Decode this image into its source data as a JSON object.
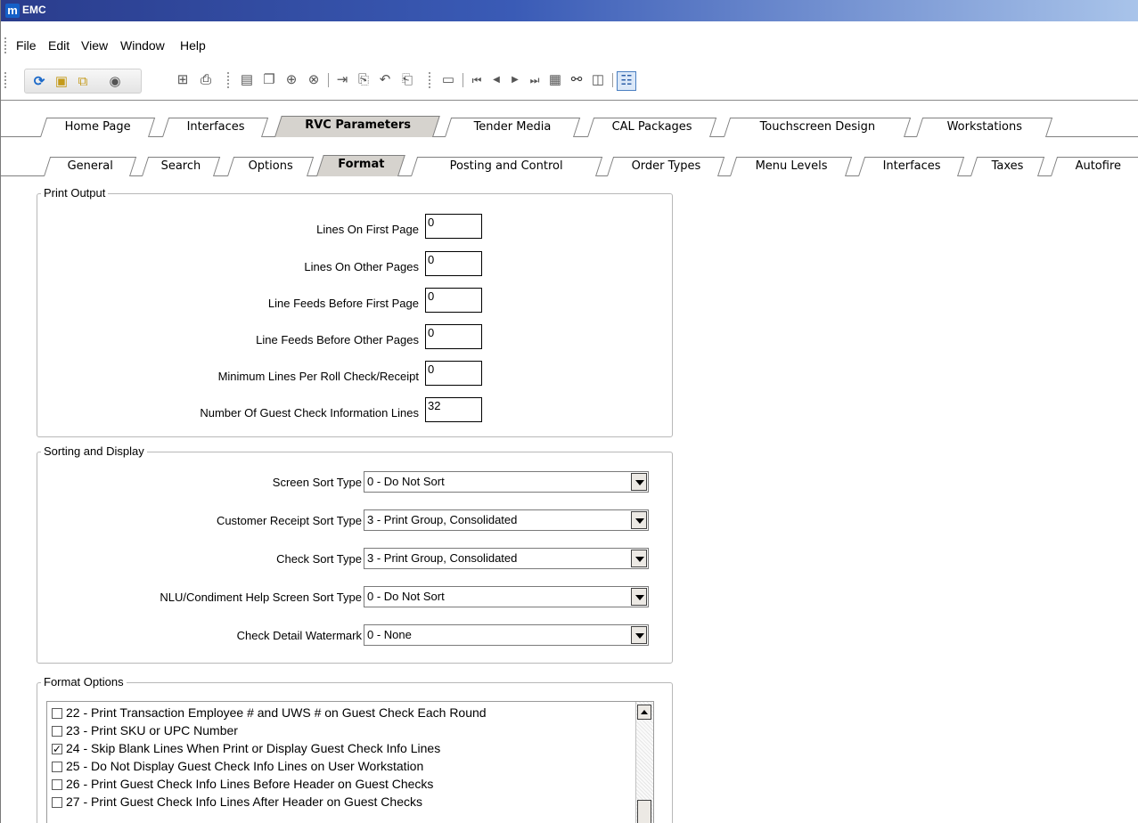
{
  "window": {
    "logo": "m",
    "title": "EMC"
  },
  "menu": [
    "File",
    "Edit",
    "View",
    "Window",
    "Help"
  ],
  "toolbar_icons": [
    "refresh-icon",
    "new-icon",
    "new-multiple-icon",
    "circle-icon",
    "calculator-icon",
    "print-icon",
    "save-icon",
    "save-all-icon",
    "add-icon",
    "delete-icon",
    "insert-record-icon",
    "copy-icon",
    "undo-icon",
    "paste-icon",
    "page-icon",
    "first-record-icon",
    "previous-record-icon",
    "next-record-icon",
    "last-record-icon",
    "goto-record-icon",
    "find-icon",
    "form-view-icon",
    "table-view-icon"
  ],
  "main_tabs": [
    "Home Page",
    "Interfaces",
    "RVC Parameters",
    "Tender Media",
    "CAL Packages",
    "Touchscreen Design",
    "Workstations"
  ],
  "main_tab_active": "RVC Parameters",
  "sub_tabs": [
    "General",
    "Search",
    "Options",
    "Format",
    "Posting and Control",
    "Order Types",
    "Menu Levels",
    "Interfaces",
    "Taxes",
    "Autofire"
  ],
  "sub_tab_active": "Format",
  "print_output": {
    "legend": "Print Output",
    "fields": [
      {
        "label": "Lines On First Page",
        "value": "0"
      },
      {
        "label": "Lines On Other Pages",
        "value": "0"
      },
      {
        "label": "Line Feeds Before First Page",
        "value": "0"
      },
      {
        "label": "Line Feeds Before Other Pages",
        "value": "0"
      },
      {
        "label": "Minimum Lines Per Roll Check/Receipt",
        "value": "0"
      },
      {
        "label": "Number Of Guest Check Information Lines",
        "value": "32"
      }
    ]
  },
  "sorting_display": {
    "legend": "Sorting and Display",
    "fields": [
      {
        "label": "Screen Sort Type",
        "value": "0 - Do Not Sort"
      },
      {
        "label": "Customer Receipt Sort Type",
        "value": "3 - Print Group, Consolidated"
      },
      {
        "label": "Check Sort Type",
        "value": "3 - Print Group, Consolidated"
      },
      {
        "label": "NLU/Condiment Help Screen Sort Type",
        "value": "0 - Do Not Sort"
      },
      {
        "label": "Check Detail Watermark",
        "value": "0 - None"
      }
    ]
  },
  "format_options": {
    "legend": "Format Options",
    "items": [
      {
        "label": "22 - Print Transaction Employee # and UWS # on Guest Check Each Round",
        "checked": false
      },
      {
        "label": "23 - Print SKU or UPC Number",
        "checked": false
      },
      {
        "label": "24 - Skip Blank Lines When Print or Display Guest Check Info Lines",
        "checked": true
      },
      {
        "label": "25 - Do Not Display Guest Check Info Lines on User Workstation",
        "checked": false
      },
      {
        "label": "26 - Print Guest Check Info Lines Before Header on Guest Checks",
        "checked": false
      },
      {
        "label": "27 - Print Guest Check Info Lines After Header on Guest Checks",
        "checked": false
      }
    ]
  }
}
